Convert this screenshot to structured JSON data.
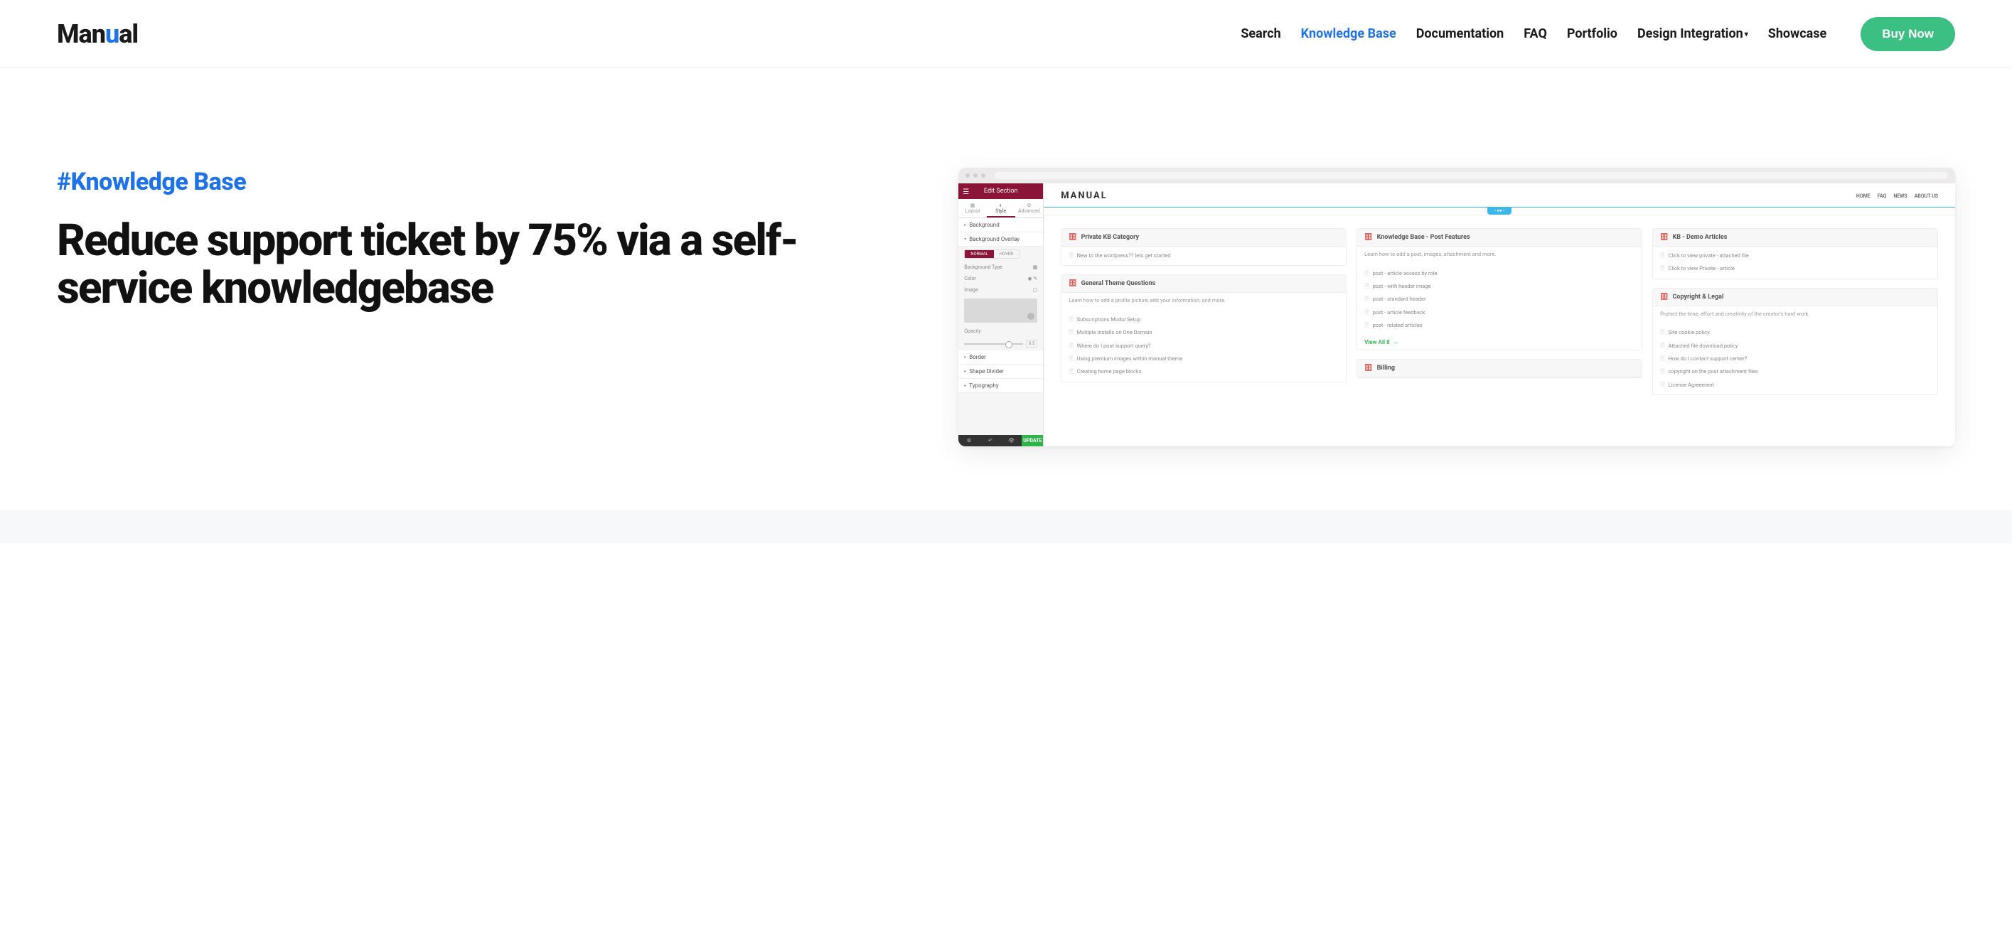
{
  "header": {
    "logo_parts": {
      "pre": "Man",
      "u": "u",
      "post": "al"
    },
    "nav": [
      "Search",
      "Knowledge Base",
      "Documentation",
      "FAQ",
      "Portfolio",
      "Design Integration",
      "Showcase"
    ],
    "active_index": 1,
    "dropdown_index": 5,
    "cta": "Buy Now"
  },
  "hero": {
    "tag": "#Knowledge Base",
    "headline": "Reduce support ticket by 75% via a self-service knowledgebase"
  },
  "mock": {
    "editor": {
      "title": "Edit Section",
      "tabs": [
        "Layout",
        "Style",
        "Advanced"
      ],
      "active_tab": 1,
      "sections": {
        "background": "Background",
        "background_overlay": "Background Overlay",
        "border": "Border",
        "shape_divider": "Shape Divider",
        "typography": "Typography"
      },
      "toggle": {
        "normal": "NORMAL",
        "hover": "HOVER"
      },
      "labels": {
        "bg_type": "Background Type",
        "color": "Color",
        "image": "Image",
        "opacity": "Opacity"
      },
      "opacity_value": "0.5",
      "update": "UPDATE"
    },
    "preview": {
      "logo": "MANUAL",
      "nav": [
        "HOME",
        "FAQ",
        "NEWS",
        "ABOUT US"
      ],
      "cards": {
        "private_kb": {
          "title": "Private KB Category",
          "items": [
            "New to the wordpress?? lets get started"
          ]
        },
        "general_theme": {
          "title": "General Theme Questions",
          "desc": "Learn how to add a profile picture, edit your information, and more.",
          "items": [
            "Subscriptions Modul Setup",
            "Multiple Installs on One Domain",
            "Where do I post support query?",
            "Using premium images within manual theme",
            "Creating home page blocks"
          ]
        },
        "post_features": {
          "title": "Knowledge Base - Post Features",
          "desc": "Learn how to add a post, images, attachment and more.",
          "items": [
            "post - article access by role",
            "post - with header image",
            "post - standard header",
            "post - article feedback",
            "post - related articles"
          ],
          "view_all": "View All 8"
        },
        "billing": {
          "title": "Billing"
        },
        "demo_articles": {
          "title": "KB - Demo Articles",
          "items": [
            "Click to view private - attached file",
            "Click to view Private - article"
          ]
        },
        "copyright": {
          "title": "Copyright & Legal",
          "desc": "Protect the time, effort and creativity of the creator's hard work.",
          "items": [
            "Site cookie policy",
            "Attached file download policy",
            "How do I contact support center?",
            "copyright on the post attachment files",
            "License Agreement"
          ]
        }
      }
    }
  }
}
